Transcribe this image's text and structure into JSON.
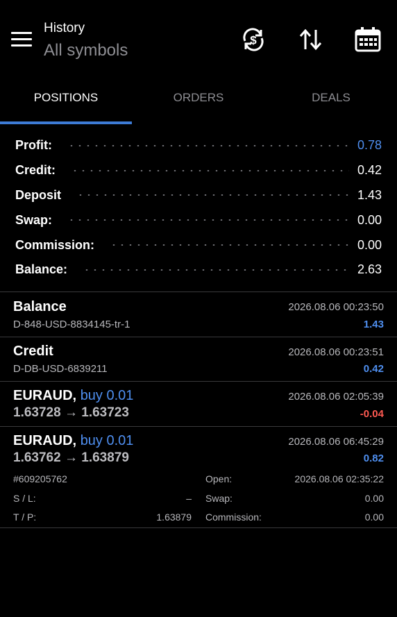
{
  "header": {
    "title": "History",
    "subtitle": "All symbols"
  },
  "tabs": [
    {
      "label": "POSITIONS"
    },
    {
      "label": "ORDERS"
    },
    {
      "label": "DEALS"
    }
  ],
  "summary": [
    {
      "label": "Profit:",
      "value": "0.78",
      "color": "#4f8ff0"
    },
    {
      "label": "Credit:",
      "value": "0.42"
    },
    {
      "label": "Deposit",
      "value": "1.43"
    },
    {
      "label": "Swap:",
      "value": "0.00"
    },
    {
      "label": "Commission:",
      "value": "0.00"
    },
    {
      "label": "Balance:",
      "value": "2.63"
    }
  ],
  "records": [
    {
      "name": "Balance",
      "sub": "D-848-USD-8834145-tr-1",
      "datetime": "2026.08.06 00:23:50",
      "value": "1.43"
    },
    {
      "name": "Credit",
      "sub": "D-DB-USD-6839211",
      "datetime": "2026.08.06 00:23:51",
      "value": "0.42"
    },
    {
      "symbol": "EURAUD,",
      "action": "buy 0.01",
      "price_open": "1.63728",
      "arrow": "→",
      "price_close": "1.63723",
      "datetime": "2026.08.06 02:05:39",
      "value": "-0.04"
    },
    {
      "symbol": "EURAUD,",
      "action": "buy 0.01",
      "price_open": "1.63762",
      "arrow": "→",
      "price_close": "1.63879",
      "datetime": "2026.08.06 06:45:29",
      "value": "0.82",
      "details": {
        "ticket": "#609205762",
        "open_label": "Open:",
        "open_value": "2026.08.06 02:35:22",
        "sl_label": "S / L:",
        "sl_value": "–",
        "swap_label": "Swap:",
        "swap_value": "0.00",
        "tp_label": "T / P:",
        "tp_value": "1.63879",
        "commission_label": "Commission:",
        "commission_value": "0.00"
      }
    }
  ],
  "icons": {
    "menu": "menu-icon",
    "sync": "currency-sync-icon",
    "sort": "sort-arrows-icon",
    "calendar": "calendar-icon"
  },
  "colors": {
    "accent": "#3d7bd6",
    "profit": "#4f8ff0",
    "loss": "#ff5a52",
    "background": "#000000"
  }
}
